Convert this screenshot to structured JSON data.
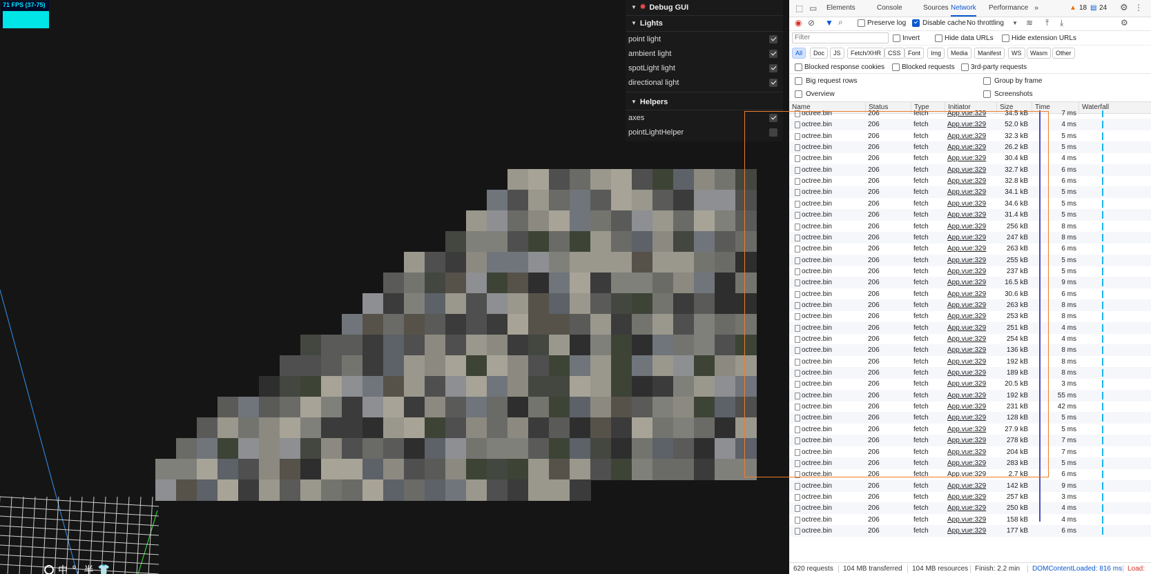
{
  "viewport": {
    "fps_label": "71 FPS (37-75)",
    "ime_bar": [
      "中",
      "°,",
      "半",
      "👕"
    ]
  },
  "debug_gui": {
    "title": "Debug GUI",
    "lights_folder": "Lights",
    "lights": [
      {
        "label": "point light",
        "checked": true
      },
      {
        "label": "ambient light",
        "checked": true
      },
      {
        "label": "spotLight light",
        "checked": true
      },
      {
        "label": "directional light",
        "checked": true
      }
    ],
    "helpers_folder": "Helpers",
    "helpers": [
      {
        "label": "axes",
        "checked": true
      },
      {
        "label": "pointLightHelper",
        "checked": false
      }
    ]
  },
  "devtools": {
    "tabs": [
      "Elements",
      "Console",
      "Sources",
      "Network",
      "Performance"
    ],
    "active_tab": "Network",
    "warnings_count": "18",
    "messages_count": "24",
    "toolbar": {
      "preserve_log": "Preserve log",
      "disable_cache": "Disable cache",
      "throttling": "No throttling"
    },
    "filter_placeholder": "Filter",
    "invert": "Invert",
    "hide_data_urls": "Hide data URLs",
    "hide_extension_urls": "Hide extension URLs",
    "type_filters": [
      "All",
      "Doc",
      "JS",
      "Fetch/XHR",
      "CSS",
      "Font",
      "Img",
      "Media",
      "Manifest",
      "WS",
      "Wasm",
      "Other"
    ],
    "blocked_response_cookies": "Blocked response cookies",
    "blocked_requests": "Blocked requests",
    "third_party_requests": "3rd-party requests",
    "big_request_rows": "Big request rows",
    "group_by_frame": "Group by frame",
    "overview": "Overview",
    "screenshots": "Screenshots",
    "columns": [
      "Name",
      "Status",
      "Type",
      "Initiator",
      "Size",
      "Time",
      "Waterfall"
    ],
    "requests": [
      {
        "name": "octree.bin",
        "status": "206",
        "type": "fetch",
        "initiator": "App.vue:329",
        "size": "34.5 kB",
        "time": "7 ms"
      },
      {
        "name": "octree.bin",
        "status": "206",
        "type": "fetch",
        "initiator": "App.vue:329",
        "size": "52.0 kB",
        "time": "4 ms"
      },
      {
        "name": "octree.bin",
        "status": "206",
        "type": "fetch",
        "initiator": "App.vue:329",
        "size": "32.3 kB",
        "time": "5 ms"
      },
      {
        "name": "octree.bin",
        "status": "206",
        "type": "fetch",
        "initiator": "App.vue:329",
        "size": "26.2 kB",
        "time": "5 ms"
      },
      {
        "name": "octree.bin",
        "status": "206",
        "type": "fetch",
        "initiator": "App.vue:329",
        "size": "30.4 kB",
        "time": "4 ms"
      },
      {
        "name": "octree.bin",
        "status": "206",
        "type": "fetch",
        "initiator": "App.vue:329",
        "size": "32.7 kB",
        "time": "6 ms"
      },
      {
        "name": "octree.bin",
        "status": "206",
        "type": "fetch",
        "initiator": "App.vue:329",
        "size": "32.8 kB",
        "time": "6 ms"
      },
      {
        "name": "octree.bin",
        "status": "206",
        "type": "fetch",
        "initiator": "App.vue:329",
        "size": "34.1 kB",
        "time": "5 ms"
      },
      {
        "name": "octree.bin",
        "status": "206",
        "type": "fetch",
        "initiator": "App.vue:329",
        "size": "34.6 kB",
        "time": "5 ms"
      },
      {
        "name": "octree.bin",
        "status": "206",
        "type": "fetch",
        "initiator": "App.vue:329",
        "size": "31.4 kB",
        "time": "5 ms"
      },
      {
        "name": "octree.bin",
        "status": "206",
        "type": "fetch",
        "initiator": "App.vue:329",
        "size": "256 kB",
        "time": "8 ms"
      },
      {
        "name": "octree.bin",
        "status": "206",
        "type": "fetch",
        "initiator": "App.vue:329",
        "size": "247 kB",
        "time": "8 ms"
      },
      {
        "name": "octree.bin",
        "status": "206",
        "type": "fetch",
        "initiator": "App.vue:329",
        "size": "263 kB",
        "time": "6 ms"
      },
      {
        "name": "octree.bin",
        "status": "206",
        "type": "fetch",
        "initiator": "App.vue:329",
        "size": "255 kB",
        "time": "5 ms"
      },
      {
        "name": "octree.bin",
        "status": "206",
        "type": "fetch",
        "initiator": "App.vue:329",
        "size": "237 kB",
        "time": "5 ms"
      },
      {
        "name": "octree.bin",
        "status": "206",
        "type": "fetch",
        "initiator": "App.vue:329",
        "size": "16.5 kB",
        "time": "9 ms"
      },
      {
        "name": "octree.bin",
        "status": "206",
        "type": "fetch",
        "initiator": "App.vue:329",
        "size": "30.6 kB",
        "time": "6 ms"
      },
      {
        "name": "octree.bin",
        "status": "206",
        "type": "fetch",
        "initiator": "App.vue:329",
        "size": "263 kB",
        "time": "8 ms"
      },
      {
        "name": "octree.bin",
        "status": "206",
        "type": "fetch",
        "initiator": "App.vue:329",
        "size": "253 kB",
        "time": "8 ms"
      },
      {
        "name": "octree.bin",
        "status": "206",
        "type": "fetch",
        "initiator": "App.vue:329",
        "size": "251 kB",
        "time": "4 ms"
      },
      {
        "name": "octree.bin",
        "status": "206",
        "type": "fetch",
        "initiator": "App.vue:329",
        "size": "254 kB",
        "time": "4 ms"
      },
      {
        "name": "octree.bin",
        "status": "206",
        "type": "fetch",
        "initiator": "App.vue:329",
        "size": "136 kB",
        "time": "8 ms"
      },
      {
        "name": "octree.bin",
        "status": "206",
        "type": "fetch",
        "initiator": "App.vue:329",
        "size": "192 kB",
        "time": "8 ms"
      },
      {
        "name": "octree.bin",
        "status": "206",
        "type": "fetch",
        "initiator": "App.vue:329",
        "size": "189 kB",
        "time": "8 ms"
      },
      {
        "name": "octree.bin",
        "status": "206",
        "type": "fetch",
        "initiator": "App.vue:329",
        "size": "20.5 kB",
        "time": "3 ms"
      },
      {
        "name": "octree.bin",
        "status": "206",
        "type": "fetch",
        "initiator": "App.vue:329",
        "size": "192 kB",
        "time": "55 ms"
      },
      {
        "name": "octree.bin",
        "status": "206",
        "type": "fetch",
        "initiator": "App.vue:329",
        "size": "231 kB",
        "time": "42 ms"
      },
      {
        "name": "octree.bin",
        "status": "206",
        "type": "fetch",
        "initiator": "App.vue:329",
        "size": "128 kB",
        "time": "5 ms"
      },
      {
        "name": "octree.bin",
        "status": "206",
        "type": "fetch",
        "initiator": "App.vue:329",
        "size": "27.9 kB",
        "time": "5 ms"
      },
      {
        "name": "octree.bin",
        "status": "206",
        "type": "fetch",
        "initiator": "App.vue:329",
        "size": "278 kB",
        "time": "7 ms"
      },
      {
        "name": "octree.bin",
        "status": "206",
        "type": "fetch",
        "initiator": "App.vue:329",
        "size": "204 kB",
        "time": "7 ms"
      },
      {
        "name": "octree.bin",
        "status": "206",
        "type": "fetch",
        "initiator": "App.vue:329",
        "size": "283 kB",
        "time": "5 ms"
      },
      {
        "name": "octree.bin",
        "status": "206",
        "type": "fetch",
        "initiator": "App.vue:329",
        "size": "2.7 kB",
        "time": "6 ms"
      },
      {
        "name": "octree.bin",
        "status": "206",
        "type": "fetch",
        "initiator": "App.vue:329",
        "size": "142 kB",
        "time": "9 ms"
      },
      {
        "name": "octree.bin",
        "status": "206",
        "type": "fetch",
        "initiator": "App.vue:329",
        "size": "257 kB",
        "time": "3 ms"
      },
      {
        "name": "octree.bin",
        "status": "206",
        "type": "fetch",
        "initiator": "App.vue:329",
        "size": "250 kB",
        "time": "4 ms"
      },
      {
        "name": "octree.bin",
        "status": "206",
        "type": "fetch",
        "initiator": "App.vue:329",
        "size": "158 kB",
        "time": "4 ms"
      },
      {
        "name": "octree.bin",
        "status": "206",
        "type": "fetch",
        "initiator": "App.vue:329",
        "size": "177 kB",
        "time": "6 ms"
      }
    ],
    "status_bar": {
      "requests": "620 requests",
      "transferred": "104 MB transferred",
      "resources": "104 MB resources",
      "finish": "Finish: 2.2 min",
      "dom_content_loaded": "DOMContentLoaded: 816 ms",
      "load": "Load:"
    },
    "colors": {
      "accent": "#0b57d0",
      "selection": "#ef7d2a",
      "waterfall": "#1ab2ef"
    }
  }
}
